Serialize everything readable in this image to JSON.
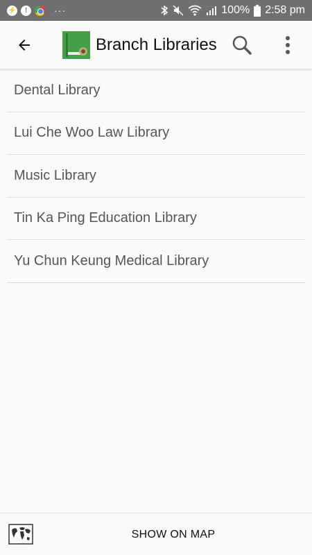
{
  "status_bar": {
    "more": "···",
    "battery": "100%",
    "time": "2:58 pm"
  },
  "app_bar": {
    "title": "Branch Libraries",
    "icons": {
      "back": "arrow-back-icon",
      "search": "search-icon",
      "menu": "more-vert-icon"
    }
  },
  "list": {
    "items": [
      {
        "label": "Dental Library"
      },
      {
        "label": "Lui Che Woo Law Library"
      },
      {
        "label": "Music Library"
      },
      {
        "label": "Tin Ka Ping Education Library"
      },
      {
        "label": "Yu Chun Keung Medical Library"
      }
    ]
  },
  "bottom_bar": {
    "show_map_label": "SHOW ON MAP",
    "map_icon": "world-map-icon"
  },
  "colors": {
    "status_bar": "#707070",
    "background": "#fafafa",
    "logo": "#43a047",
    "divider": "#dcdcdc"
  }
}
